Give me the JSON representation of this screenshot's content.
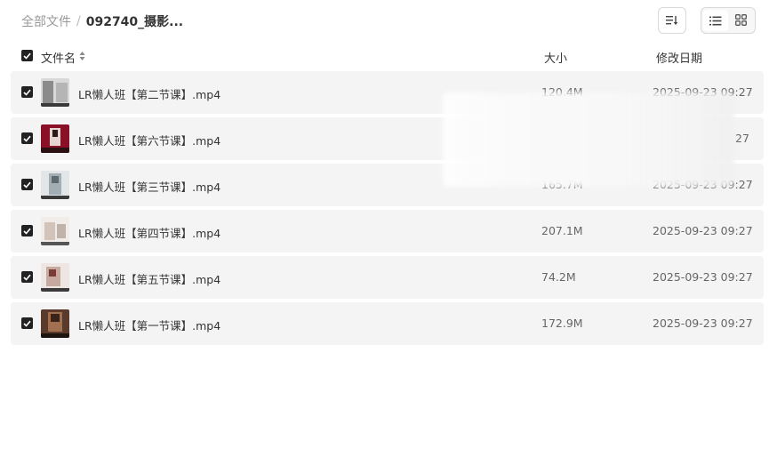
{
  "breadcrumb": {
    "root": "全部文件",
    "separator": "/",
    "current": "092740_摄影..."
  },
  "toolbar": {
    "sort_icon": "sort-descending-icon",
    "list_view_icon": "list-view-icon",
    "grid_view_icon": "grid-view-icon",
    "active_view": "list"
  },
  "columns": {
    "name": "文件名",
    "size": "大小",
    "date": "修改日期"
  },
  "files": [
    {
      "name": "LR懒人班【第二节课】.mp4",
      "size": "120.4M",
      "date": "2025-09-23 09:27",
      "checked": true,
      "thumb_color": "#c9c9c9"
    },
    {
      "name": "LR懒人班【第六节课】.mp4",
      "size": "",
      "date": "27",
      "checked": true,
      "thumb_color": "#8a1028"
    },
    {
      "name": "LR懒人班【第三节课】.mp4",
      "size": "165.7M",
      "date": "2025-09-23 09:27",
      "checked": true,
      "thumb_color": "#b7c0c4"
    },
    {
      "name": "LR懒人班【第四节课】.mp4",
      "size": "207.1M",
      "date": "2025-09-23 09:27",
      "checked": true,
      "thumb_color": "#e8e2dc"
    },
    {
      "name": "LR懒人班【第五节课】.mp4",
      "size": "74.2M",
      "date": "2025-09-23 09:27",
      "checked": true,
      "thumb_color": "#c8b8b0"
    },
    {
      "name": "LR懒人班【第一节课】.mp4",
      "size": "172.9M",
      "date": "2025-09-23 09:27",
      "checked": true,
      "thumb_color": "#5a3a2a"
    }
  ]
}
